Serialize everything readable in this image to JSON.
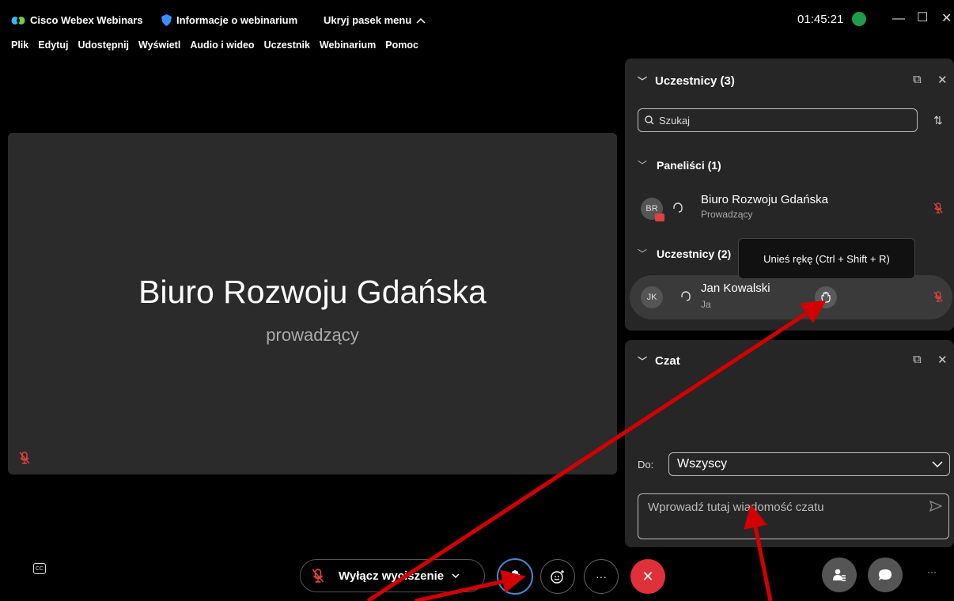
{
  "titlebar": {
    "app_title": "Cisco Webex Webinars",
    "info_label": "Informacje o webinarium",
    "hide_menu": "Ukryj pasek menu",
    "time": "01:45:21"
  },
  "menu": [
    "Plik",
    "Edytuj",
    "Udostępnij",
    "Wyświetl",
    "Audio i wideo",
    "Uczestnik",
    "Webinarium",
    "Pomoc"
  ],
  "stage": {
    "name": "Biuro Rozwoju Gdańska",
    "role": "prowadzący"
  },
  "participants_panel": {
    "title": "Uczestnicy (3)",
    "search_placeholder": "Szukaj",
    "panelists_header": "Paneliści (1)",
    "panelist": {
      "initials": "BR",
      "name": "Biuro Rozwoju Gdańska",
      "role": "Prowadzący"
    },
    "attendees_header": "Uczestnicy (2)",
    "attendee": {
      "initials": "JK",
      "name": "Jan Kowalski",
      "role": "Ja"
    },
    "tooltip": "Unieś rękę (Ctrl + Shift + R)"
  },
  "chat_panel": {
    "title": "Czat",
    "to_label": "Do:",
    "to_value": "Wszyscy",
    "input_placeholder": "Wprowadź tutaj wiadomość czatu"
  },
  "bottom": {
    "unmute_label": "Wyłącz wyciszenie",
    "more_label": "···"
  },
  "colors": {
    "accent_green": "#1f9e4a",
    "end_red": "#e0313b",
    "annotation_red": "#d40000",
    "mute_red": "#e0413b"
  }
}
